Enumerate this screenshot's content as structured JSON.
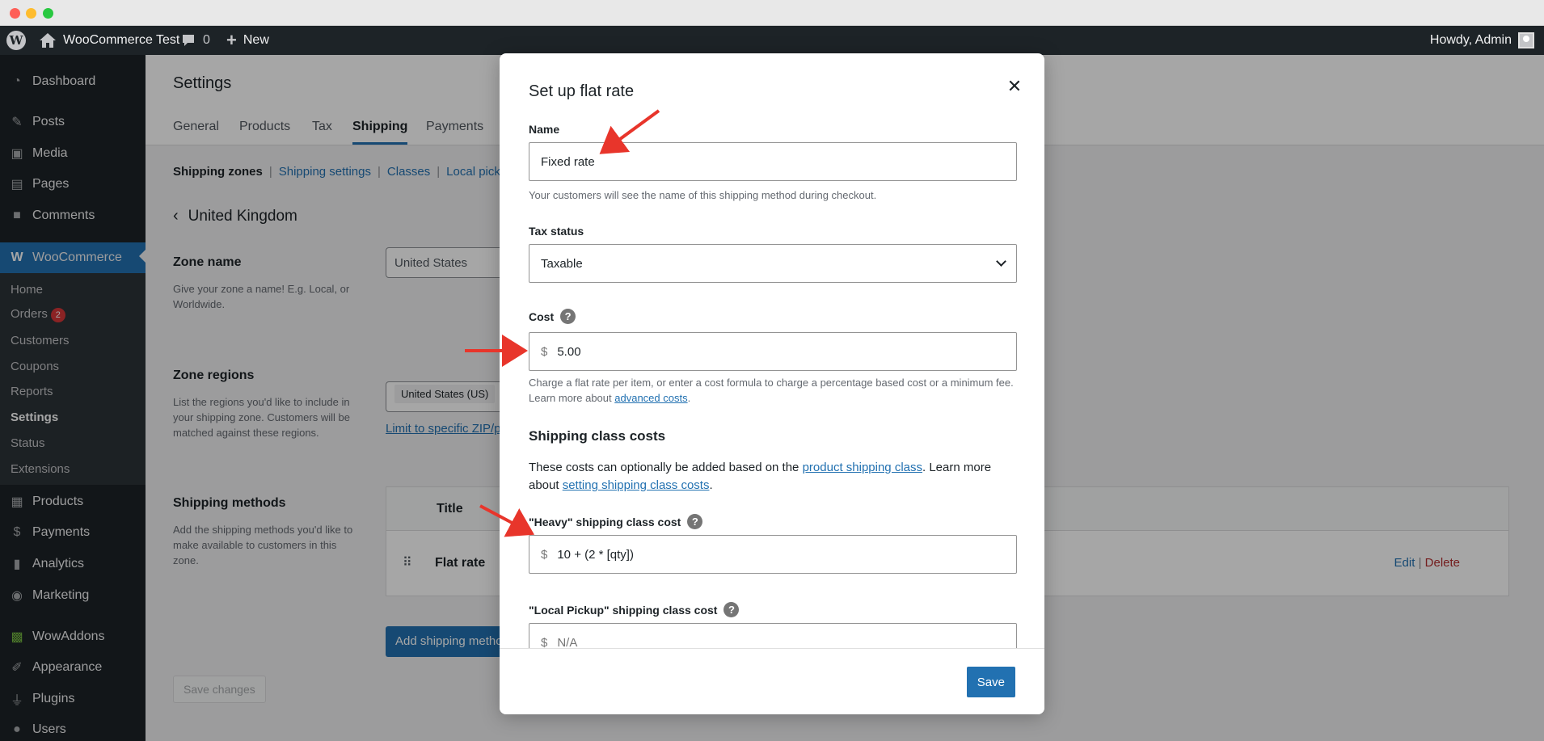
{
  "adminbar": {
    "site_name": "WooCommerce Test",
    "comments_count": "0",
    "new_label": "New",
    "howdy": "Howdy, Admin"
  },
  "sidebar": {
    "items": [
      {
        "label": "Dashboard",
        "icon": "dashboard-icon"
      },
      {
        "label": "Posts",
        "icon": "pin-icon"
      },
      {
        "label": "Media",
        "icon": "media-icon"
      },
      {
        "label": "Pages",
        "icon": "pages-icon"
      },
      {
        "label": "Comments",
        "icon": "comment-icon"
      },
      {
        "label": "WooCommerce",
        "icon": "woo-icon"
      },
      {
        "label": "Products",
        "icon": "box-icon"
      },
      {
        "label": "Payments",
        "icon": "dollar-icon"
      },
      {
        "label": "Analytics",
        "icon": "bar-chart-icon"
      },
      {
        "label": "Marketing",
        "icon": "megaphone-icon"
      },
      {
        "label": "WowAddons",
        "icon": "grid-icon"
      },
      {
        "label": "Appearance",
        "icon": "brush-icon"
      },
      {
        "label": "Plugins",
        "icon": "plug-icon"
      },
      {
        "label": "Users",
        "icon": "user-icon"
      }
    ],
    "woo_submenu": [
      {
        "label": "Home"
      },
      {
        "label": "Orders",
        "badge": "2"
      },
      {
        "label": "Customers"
      },
      {
        "label": "Coupons"
      },
      {
        "label": "Reports"
      },
      {
        "label": "Settings"
      },
      {
        "label": "Status"
      },
      {
        "label": "Extensions"
      }
    ]
  },
  "settings": {
    "title": "Settings",
    "tabs": [
      "General",
      "Products",
      "Tax",
      "Shipping",
      "Payments"
    ],
    "sublinks": [
      "Shipping zones",
      "Shipping settings",
      "Classes",
      "Local pickup"
    ],
    "zone_title": "United Kingdom",
    "zone_name_label": "Zone name",
    "zone_name_desc": "Give your zone a name! E.g. Local, or Worldwide.",
    "zone_name_value": "United States",
    "zone_regions_label": "Zone regions",
    "zone_regions_desc": "List the regions you'd like to include in your shipping zone. Customers will be matched against these regions.",
    "region_chip": "United States (US)",
    "limit_link": "Limit to specific ZIP/p",
    "methods_label": "Shipping methods",
    "methods_desc": "Add the shipping methods you'd like to make available to customers in this zone.",
    "table_title_header": "Title",
    "method_row_name": "Flat rate",
    "edit_label": "Edit",
    "delete_label": "Delete",
    "add_method_label": "Add shipping metho",
    "save_changes_label": "Save changes"
  },
  "modal": {
    "title": "Set up flat rate",
    "name_label": "Name",
    "name_value": "Fixed rate",
    "name_help": "Your customers will see the name of this shipping method during checkout.",
    "tax_label": "Tax status",
    "tax_value": "Taxable",
    "cost_label": "Cost",
    "currency": "$",
    "cost_value": "5.00",
    "cost_help_text": "Charge a flat rate per item, or enter a cost formula to charge a percentage based cost or a minimum fee. Learn more about",
    "cost_help_link": "advanced costs",
    "class_heading": "Shipping class costs",
    "class_para_1": "These costs can optionally be added based on the",
    "class_link_1": "product shipping class",
    "class_para_2": ". Learn more about",
    "class_link_2": "setting shipping class costs",
    "heavy_label": "\"Heavy\" shipping class cost",
    "heavy_value": "10 + (2 * [qty])",
    "pickup_label": "\"Local Pickup\" shipping class cost",
    "pickup_placeholder": "N/A",
    "save_label": "Save"
  }
}
